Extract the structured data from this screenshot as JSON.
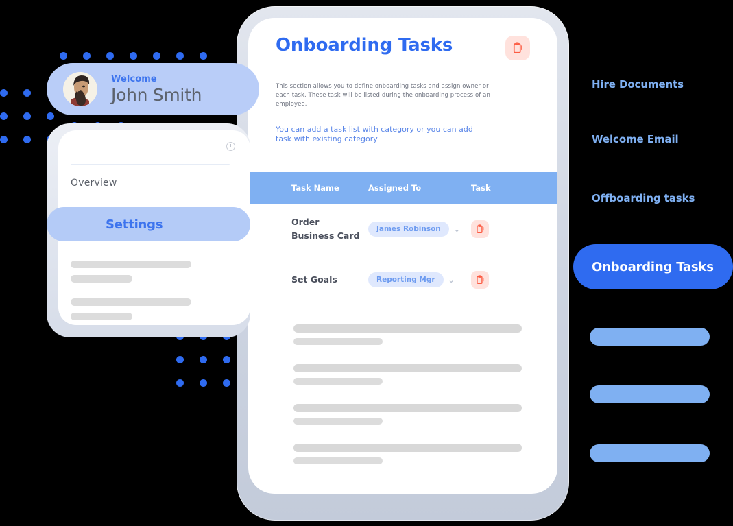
{
  "phone": {
    "title": "Onboarding Tasks",
    "header_icon": "clipboard-icon",
    "description": "This section allows you to define onboarding tasks and assign owner or each task. These task will be listed during the onboarding process of an employee.",
    "link_text": "You can add a task list with category or you can add task with existing category",
    "table": {
      "columns": [
        "Task Name",
        "Assigned To",
        "Task"
      ],
      "rows": [
        {
          "task_name": "Order Business Card",
          "assigned_to": "James Robinson",
          "chevron": "⌄",
          "action_icon": "clipboard-icon"
        },
        {
          "task_name": "Set Goals",
          "assigned_to": "Reporting Mgr",
          "chevron": "⌄",
          "action_icon": "clipboard-icon"
        }
      ]
    },
    "skeleton_rows": 4
  },
  "welcome_card": {
    "greeting": "Welcome",
    "name": "John Smith",
    "avatar": "user-avatar"
  },
  "left_panel": {
    "info_icon": "info-icon",
    "info_glyph": "i",
    "overview_label": "Overview",
    "settings_label": "Settings",
    "skeleton_groups": 2
  },
  "right_menu": {
    "items": [
      {
        "label": "Hire Documents",
        "active": false
      },
      {
        "label": "Welcome Email",
        "active": false
      },
      {
        "label": "Offboarding tasks",
        "active": false
      },
      {
        "label": "Onboarding Tasks",
        "active": true
      }
    ],
    "placeholder_bars": 3
  },
  "colors": {
    "background": "#000000",
    "accent_blue": "#2f6bf0",
    "light_blue": "#7fb0f2",
    "pill_blue": "#b4cbf7",
    "card_blue": "#b9cdf8",
    "chip_bg": "#dfe8fd",
    "chip_text": "#6d9bf0",
    "icon_chip_bg": "#ffe2dd",
    "icon_red": "#fc5c43",
    "skeleton_grey": "#d8d8d8",
    "text_grey": "#5b6069",
    "dot_blue": "#2f6bf0"
  }
}
